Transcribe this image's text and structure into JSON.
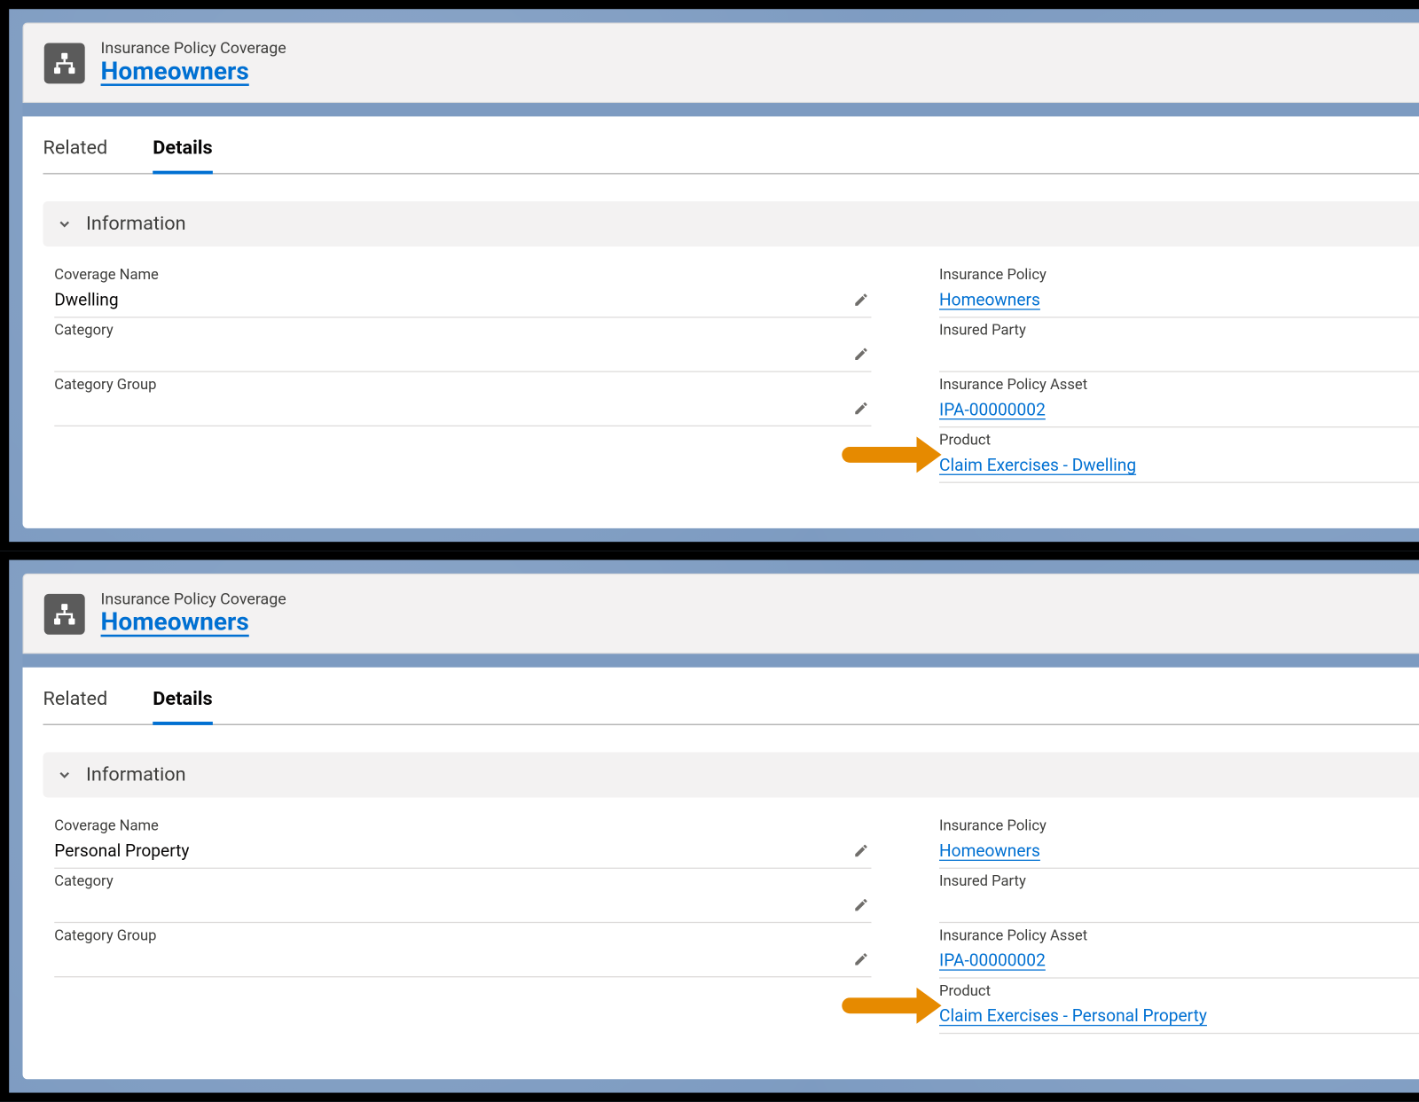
{
  "panels": [
    {
      "header": {
        "breadcrumb": "Insurance Policy Coverage",
        "title": "Homeowners"
      },
      "tabs": {
        "related": "Related",
        "details": "Details"
      },
      "section": {
        "title": "Information"
      },
      "left_fields": [
        {
          "label": "Coverage Name",
          "value": "Dwelling",
          "link": false
        },
        {
          "label": "Category",
          "value": "",
          "link": false
        },
        {
          "label": "Category Group",
          "value": "",
          "link": false
        }
      ],
      "right_fields": [
        {
          "label": "Insurance Policy",
          "value": "Homeowners",
          "link": true,
          "arrow": false
        },
        {
          "label": "Insured Party",
          "value": "",
          "link": false,
          "arrow": false
        },
        {
          "label": "Insurance Policy Asset",
          "value": "IPA-00000002",
          "link": true,
          "arrow": false
        },
        {
          "label": "Product",
          "value": "Claim Exercises - Dwelling",
          "link": true,
          "arrow": true
        }
      ]
    },
    {
      "header": {
        "breadcrumb": "Insurance Policy Coverage",
        "title": "Homeowners"
      },
      "tabs": {
        "related": "Related",
        "details": "Details"
      },
      "section": {
        "title": "Information"
      },
      "left_fields": [
        {
          "label": "Coverage Name",
          "value": "Personal Property",
          "link": false
        },
        {
          "label": "Category",
          "value": "",
          "link": false
        },
        {
          "label": "Category Group",
          "value": "",
          "link": false
        }
      ],
      "right_fields": [
        {
          "label": "Insurance Policy",
          "value": "Homeowners",
          "link": true,
          "arrow": false
        },
        {
          "label": "Insured Party",
          "value": "",
          "link": false,
          "arrow": false
        },
        {
          "label": "Insurance Policy Asset",
          "value": "IPA-00000002",
          "link": true,
          "arrow": false
        },
        {
          "label": "Product",
          "value": "Claim Exercises - Personal Property",
          "link": true,
          "arrow": true
        }
      ]
    }
  ]
}
